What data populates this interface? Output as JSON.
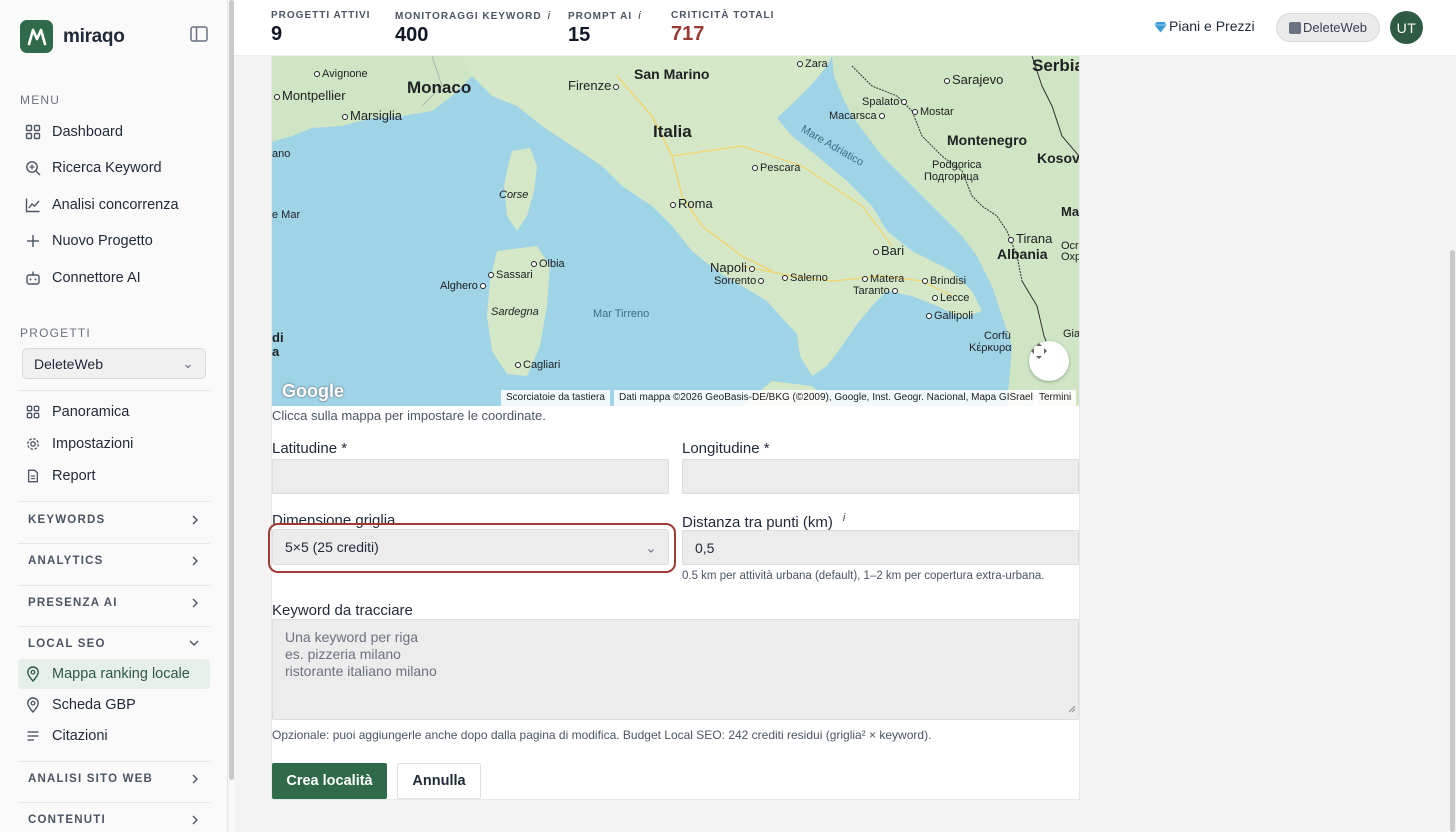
{
  "brand": {
    "name": "miraqo"
  },
  "sidebar": {
    "menu_label": "MENU",
    "menu_items": [
      {
        "label": "Dashboard",
        "icon": "grid-icon"
      },
      {
        "label": "Ricerca Keyword",
        "icon": "search-icon"
      },
      {
        "label": "Analisi concorrenza",
        "icon": "chart-line-icon"
      },
      {
        "label": "Nuovo Progetto",
        "icon": "plus-icon"
      },
      {
        "label": "Connettore AI",
        "icon": "robot-icon"
      }
    ],
    "projects_label": "PROGETTI",
    "project_selected": "DeleteWeb",
    "project_items": [
      {
        "label": "Panoramica",
        "icon": "grid-icon"
      },
      {
        "label": "Impostazioni",
        "icon": "gear-icon"
      },
      {
        "label": "Report",
        "icon": "document-icon"
      }
    ],
    "groups": [
      {
        "label": "KEYWORDS",
        "expanded": false
      },
      {
        "label": "ANALYTICS",
        "expanded": false
      },
      {
        "label": "PRESENZA AI",
        "expanded": false
      },
      {
        "label": "LOCAL SEO",
        "expanded": true
      },
      {
        "label": "ANALISI SITO WEB",
        "expanded": false
      },
      {
        "label": "CONTENUTI",
        "expanded": false
      }
    ],
    "local_seo_items": [
      {
        "label": "Mappa ranking locale",
        "icon": "map-pin-icon",
        "active": true
      },
      {
        "label": "Scheda GBP",
        "icon": "map-pin-icon",
        "active": false
      },
      {
        "label": "Citazioni",
        "icon": "list-icon",
        "active": false
      }
    ]
  },
  "topbar": {
    "stats": [
      {
        "label": "PROGETTI ATTIVI",
        "value": "9",
        "info": ""
      },
      {
        "label": "MONITORAGGI KEYWORD",
        "value": "400",
        "info": "i"
      },
      {
        "label": "PROMPT AI",
        "value": "15",
        "info": "i"
      },
      {
        "label": "CRITICITÀ TOTALI",
        "value": "717",
        "info": ""
      }
    ],
    "plans_label": "Piani e Prezzi",
    "account_label": "DeleteWeb",
    "avatar_initials": "UT"
  },
  "map": {
    "labels": {
      "monaco": "Monaco",
      "san_marino": "San Marino",
      "italia": "Italia",
      "montenegro": "Montenegro",
      "albania": "Albania",
      "serbia": "Serbia",
      "kosovo": "Kosov",
      "avignone": "Avignone",
      "montpellier": "Montpellier",
      "marsiglia": "Marsiglia",
      "firenze": "Firenze",
      "zara": "Zara",
      "sarajevo": "Sarajevo",
      "spalato": "Spalato",
      "makarska": "Macarsca",
      "mostar": "Mostar",
      "podgorica": "Podgorica",
      "podgorica_cyr": "Подгорица",
      "pescara": "Pescara",
      "roma": "Roma",
      "bari": "Bari",
      "tirana": "Tirana",
      "napoli": "Napoli",
      "sorrento": "Sorrento",
      "salerno": "Salerno",
      "matera": "Matera",
      "taranto": "Taranto",
      "brindisi": "Brindisi",
      "lecce": "Lecce",
      "gallipoli": "Gallipoli",
      "olbia": "Olbia",
      "sassari": "Sassari",
      "alghero": "Alghero",
      "cagliari": "Cagliari",
      "corse": "Corse",
      "sardegna": "Sardegna",
      "corfu": "Corfù",
      "corfu_gr": "Κέρκυρα",
      "mare_adriatico": "Mare Adriatico",
      "mar_tirreno": "Mar Tirreno",
      "ano": "ano",
      "e_mar": "e Mar",
      "di": "di",
      "a": "a",
      "ma": "Ma",
      "ocr": "Ocr",
      "oxr": "Oxp",
      "gia": "Gia"
    },
    "google": "Google",
    "attr_shortcuts": "Scorciatoie da tastiera",
    "attr_data": "Dati mappa ©2026 GeoBasis-DE/BKG (©2009), Google, Inst. Geogr. Nacional, Mapa GISrael",
    "attr_terms": "Termini"
  },
  "form": {
    "hint": "Clicca sulla mappa per impostare le coordinate.",
    "latitude_label": "Latitudine *",
    "latitude_value": "",
    "longitude_label": "Longitudine *",
    "longitude_value": "",
    "grid_label": "Dimensione griglia",
    "grid_value": "5×5 (25 crediti)",
    "distance_label": "Distanza tra punti (km)",
    "distance_info": "i",
    "distance_value": "0,5",
    "distance_help": "0.5 km per attività urbana (default), 1–2 km per copertura extra-urbana.",
    "keywords_label": "Keyword da tracciare",
    "keywords_placeholder_1": "Una keyword per riga",
    "keywords_placeholder_2": "es. pizzeria milano",
    "keywords_placeholder_3": "ristorante italiano milano",
    "keywords_help": "Opzionale: puoi aggiungerle anche dopo dalla pagina di modifica. Budget Local SEO: 242 crediti residui (griglia² × keyword).",
    "submit_label": "Crea località",
    "cancel_label": "Annulla"
  }
}
